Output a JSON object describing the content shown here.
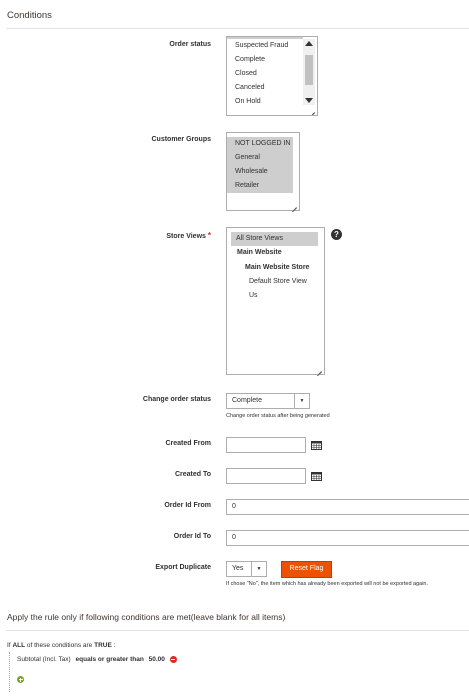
{
  "conditions_section": {
    "title": "Conditions"
  },
  "order_status": {
    "label": "Order status",
    "options": [
      "Suspected Fraud",
      "Complete",
      "Closed",
      "Canceled",
      "On Hold"
    ]
  },
  "customer_groups": {
    "label": "Customer Groups",
    "options": [
      "NOT LOGGED IN",
      "General",
      "Wholesale",
      "Retailer"
    ]
  },
  "store_views": {
    "label": "Store Views",
    "required_mark": "*",
    "help": "?",
    "options": [
      "All Store Views",
      "Main Website",
      "Main Website Store",
      "Default Store View",
      "Us"
    ]
  },
  "change_order_status": {
    "label": "Change order status",
    "value": "Complete",
    "note": "Change order status after being generated"
  },
  "created_from": {
    "label": "Created From",
    "value": ""
  },
  "created_to": {
    "label": "Created To",
    "value": ""
  },
  "order_id_from": {
    "label": "Order Id From",
    "value": "0"
  },
  "order_id_to": {
    "label": "Order Id To",
    "value": "0"
  },
  "export_duplicate": {
    "label": "Export Duplicate",
    "value": "Yes",
    "reset_label": "Reset Flag",
    "note": "If chose \"No\", the item which has already been exported will not be exported again."
  },
  "rule_section": {
    "title": "Apply the rule only if following conditions are met(leave blank for all items)",
    "if_text": "If",
    "all_text": "ALL",
    "mid_text": "of these conditions are",
    "true_text": "TRUE",
    "colon": ":",
    "condition": {
      "attribute": "Subtotal (Incl. Tax)",
      "operator": "equals or greater than",
      "value": "50.00"
    }
  },
  "colors": {
    "accent": "#eb5202",
    "required": "#e22626",
    "add": "#79a22e",
    "remove": "#e22626"
  }
}
